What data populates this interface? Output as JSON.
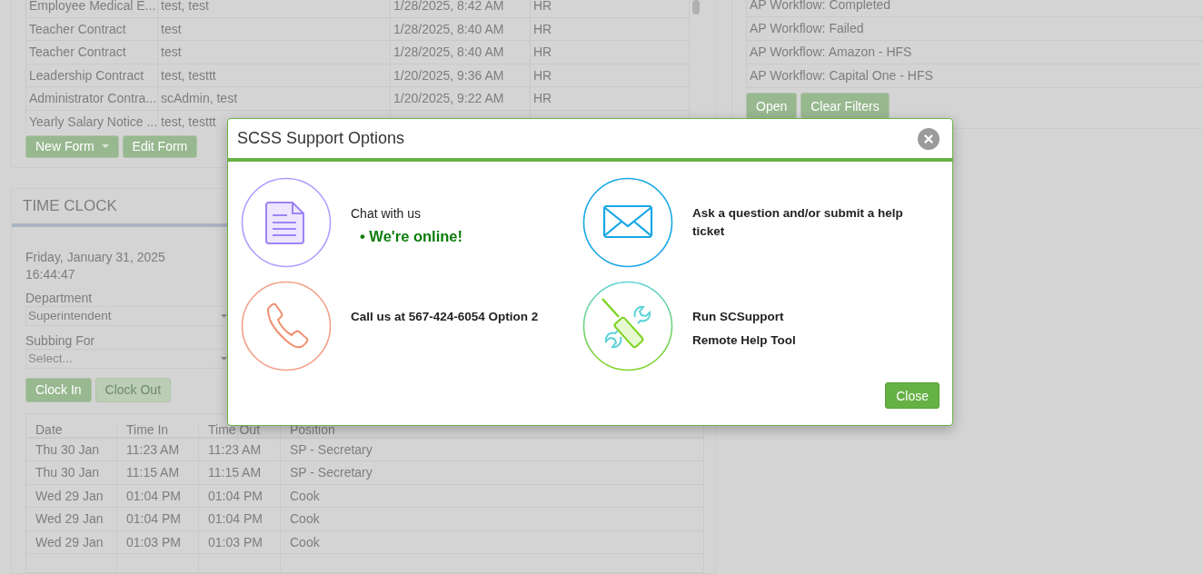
{
  "forms_table": {
    "rows": [
      [
        "Employee Medical E...",
        "test, test",
        "1/28/2025, 8:42 AM",
        "HR"
      ],
      [
        "Teacher Contract",
        "test",
        "1/28/2025, 8:40 AM",
        "HR"
      ],
      [
        "Teacher Contract",
        "test",
        "1/28/2025, 8:40 AM",
        "HR"
      ],
      [
        "Leadership Contract",
        "test, testtt",
        "1/20/2025, 9:36 AM",
        "HR"
      ],
      [
        "Administrator Contra...",
        "scAdmin, test",
        "1/20/2025, 9:22 AM",
        "HR"
      ],
      [
        "Yearly Salary Notice ...",
        "test, testtt"
      ]
    ]
  },
  "forms_buttons": [
    {
      "label": "New Form",
      "kind": "dropdown"
    },
    {
      "label": "Edit Form",
      "kind": "plain"
    }
  ],
  "time_clock": {
    "title": "TIME CLOCK",
    "date": "Friday, January 31, 2025",
    "time": "16:44:47",
    "fields": [
      {
        "label": "Department",
        "value": "Superintendent"
      },
      {
        "label": "Subbing For",
        "placeholder": "Select..."
      }
    ],
    "buttons": [
      {
        "label": "Clock In",
        "disabled": false
      },
      {
        "label": "Clock Out",
        "disabled": true
      }
    ],
    "table": {
      "columns": [
        "Date",
        "Time In",
        "Time Out",
        "Position"
      ],
      "rows": [
        [
          "Thu 30 Jan",
          "11:23 AM",
          "11:23 AM",
          "SP - Secretary"
        ],
        [
          "Thu 30 Jan",
          "11:15 AM",
          "11:15 AM",
          "SP - Secretary"
        ],
        [
          "Wed 29 Jan",
          "01:04 PM",
          "01:04 PM",
          "Cook"
        ],
        [
          "Wed 29 Jan",
          "01:04 PM",
          "01:04 PM",
          "Cook"
        ],
        [
          "Wed 29 Jan",
          "01:03 PM",
          "01:03 PM",
          "Cook"
        ]
      ]
    }
  },
  "workflows": {
    "items": [
      "AP Workflow: Completed",
      "AP Workflow: Failed",
      "AP Workflow: Amazon - HFS",
      "AP Workflow: Capital One - HFS"
    ],
    "buttons": [
      "Open",
      "Clear Filters"
    ]
  },
  "dialog": {
    "title": "SCSS Support Options",
    "options": [
      {
        "kind": "chat",
        "lines": [
          "Chat with us"
        ],
        "status": "• We're online!"
      },
      {
        "kind": "ticket",
        "lines": [
          "Ask a question and/or submit a help ticket"
        ]
      },
      {
        "kind": "phone",
        "lines": [
          "Call us at 567-424-6054 Option 2"
        ]
      },
      {
        "kind": "remote",
        "lines": [
          "Run SCSupport",
          "Remote Help Tool"
        ]
      }
    ],
    "close_button": "Close"
  }
}
